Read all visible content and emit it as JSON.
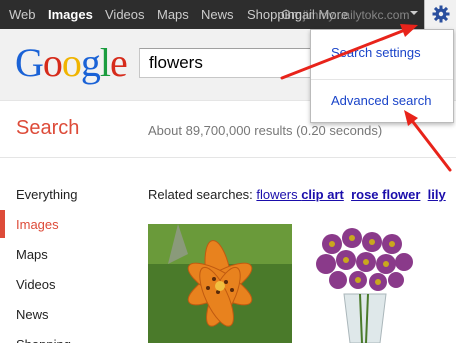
{
  "topbar": {
    "items": [
      "Web",
      "Images",
      "Videos",
      "Maps",
      "News",
      "Shopping"
    ],
    "overlap_text": "Gmail  More",
    "account_text": "jimmy...ailytokc.com",
    "active_index": 1
  },
  "header": {
    "logo": "Google",
    "search_value": "flowers"
  },
  "menu": {
    "items": [
      "Search settings",
      "Advanced search"
    ]
  },
  "results": {
    "section_title": "Search",
    "stats": "About 89,700,000 results (0.20 seconds)"
  },
  "left_nav": {
    "items": [
      "Everything",
      "Images",
      "Maps",
      "Videos",
      "News",
      "Shopping"
    ],
    "active_index": 1
  },
  "related": {
    "label": "Related searches:",
    "links": [
      {
        "normal": "flowers ",
        "bold": "clip art"
      },
      {
        "normal": "",
        "bold": "rose flower"
      },
      {
        "normal": "",
        "bold": "lily"
      }
    ]
  },
  "colors": {
    "accent_red": "#dd4b39",
    "link_blue": "#1a0dab",
    "annotation_red": "#e8231a"
  }
}
